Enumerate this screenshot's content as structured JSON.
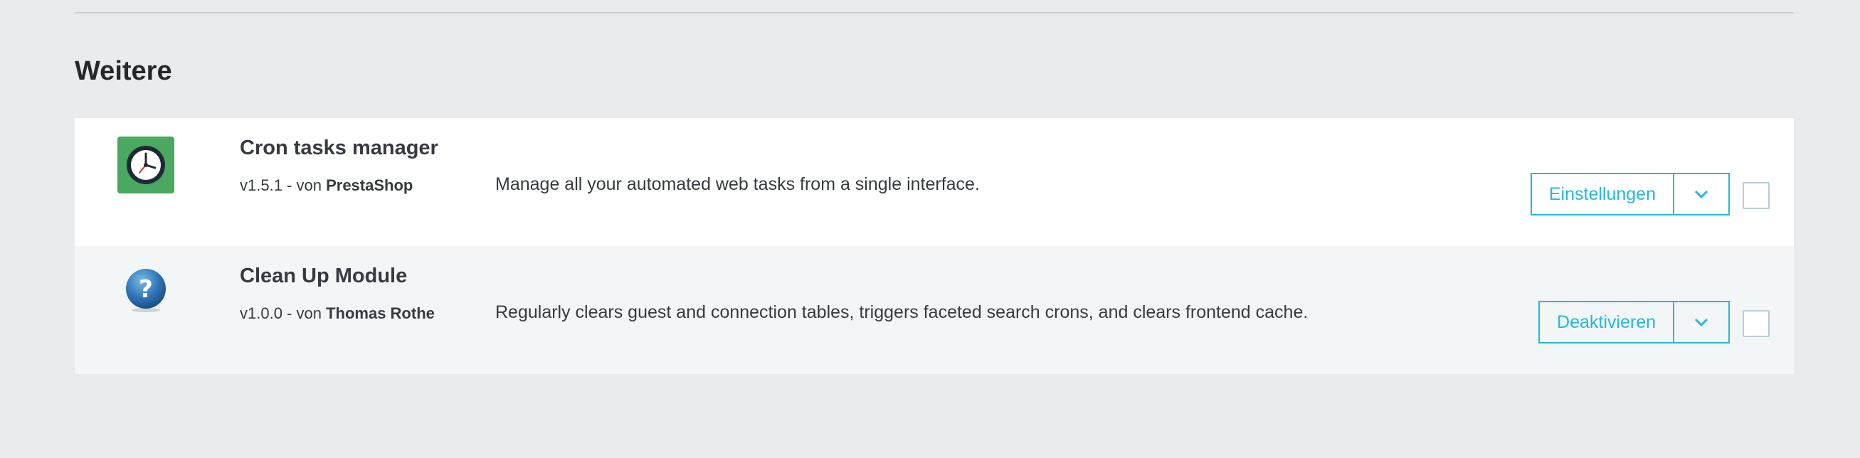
{
  "section": {
    "title": "Weitere"
  },
  "modules": [
    {
      "name": "Cron tasks manager",
      "version": "v1.5.1",
      "by": " - von ",
      "author": "PrestaShop",
      "description": "Manage all your automated web tasks from a single interface.",
      "action_label": "Einstellungen",
      "icon": "clock-icon"
    },
    {
      "name": "Clean Up Module",
      "version": "v1.0.0",
      "by": " - von ",
      "author": "Thomas Rothe",
      "description": "Regularly clears guest and connection tables, triggers faceted search crons, and clears frontend cache.",
      "action_label": "Deaktivieren",
      "icon": "question-mark-icon"
    }
  ],
  "colors": {
    "accent": "#25b9d7",
    "background": "#eaebed",
    "row_alt": "#f3f6f7",
    "cron_logo": "#4aa860"
  }
}
